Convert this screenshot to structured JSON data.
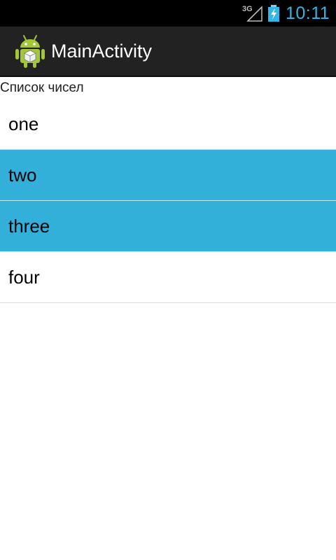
{
  "status_bar": {
    "network_label": "3G",
    "time": "10:11",
    "signal_icon": "signal-icon",
    "battery_icon": "battery-charging-icon",
    "time_color": "#33b5e5"
  },
  "action_bar": {
    "title": "MainActivity",
    "icon": "android-app-icon"
  },
  "list": {
    "header": "Список чисел",
    "items": [
      {
        "label": "one",
        "selected": false
      },
      {
        "label": "two",
        "selected": true
      },
      {
        "label": "three",
        "selected": true
      },
      {
        "label": "four",
        "selected": false
      }
    ],
    "selected_color": "#33b0da"
  }
}
